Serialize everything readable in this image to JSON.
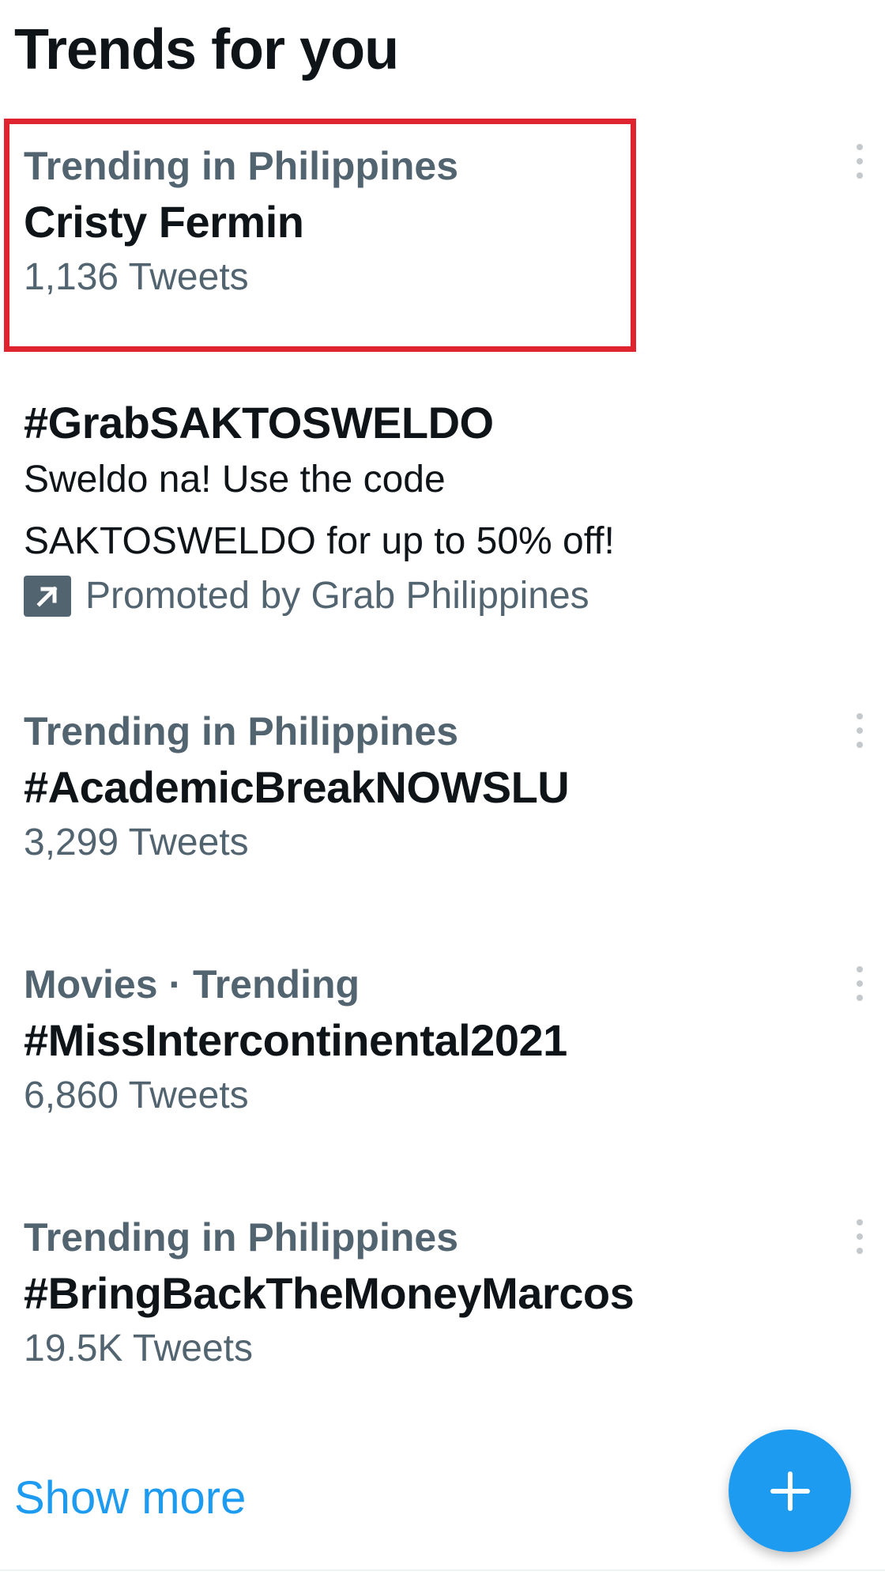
{
  "header": {
    "title": "Trends for you"
  },
  "trends": [
    {
      "context": "Trending in Philippines",
      "name": "Cristy Fermin",
      "count": "1,136 Tweets"
    },
    {
      "name": "#GrabSAKTOSWELDO",
      "description_line1": "Sweldo na! Use the code",
      "description_line2": "SAKTOSWELDO for up to 50% off!",
      "promoted_by": "Promoted by Grab Philippines"
    },
    {
      "context": "Trending in Philippines",
      "name": "#AcademicBreakNOWSLU",
      "count": "3,299 Tweets"
    },
    {
      "context": "Movies · Trending",
      "name": "#MissIntercontinental2021",
      "count": "6,860 Tweets"
    },
    {
      "context": "Trending in Philippines",
      "name": "#BringBackTheMoneyMarcos",
      "count": "19.5K Tweets"
    }
  ],
  "footer": {
    "show_more": "Show more"
  },
  "icons": {
    "more": "more-vertical-icon",
    "promoted": "promoted-arrow-icon",
    "compose": "plus-icon"
  },
  "colors": {
    "accent": "#1d9bf0",
    "highlight": "#e0242f",
    "secondary_text": "#536471",
    "primary_text": "#0f1419"
  }
}
